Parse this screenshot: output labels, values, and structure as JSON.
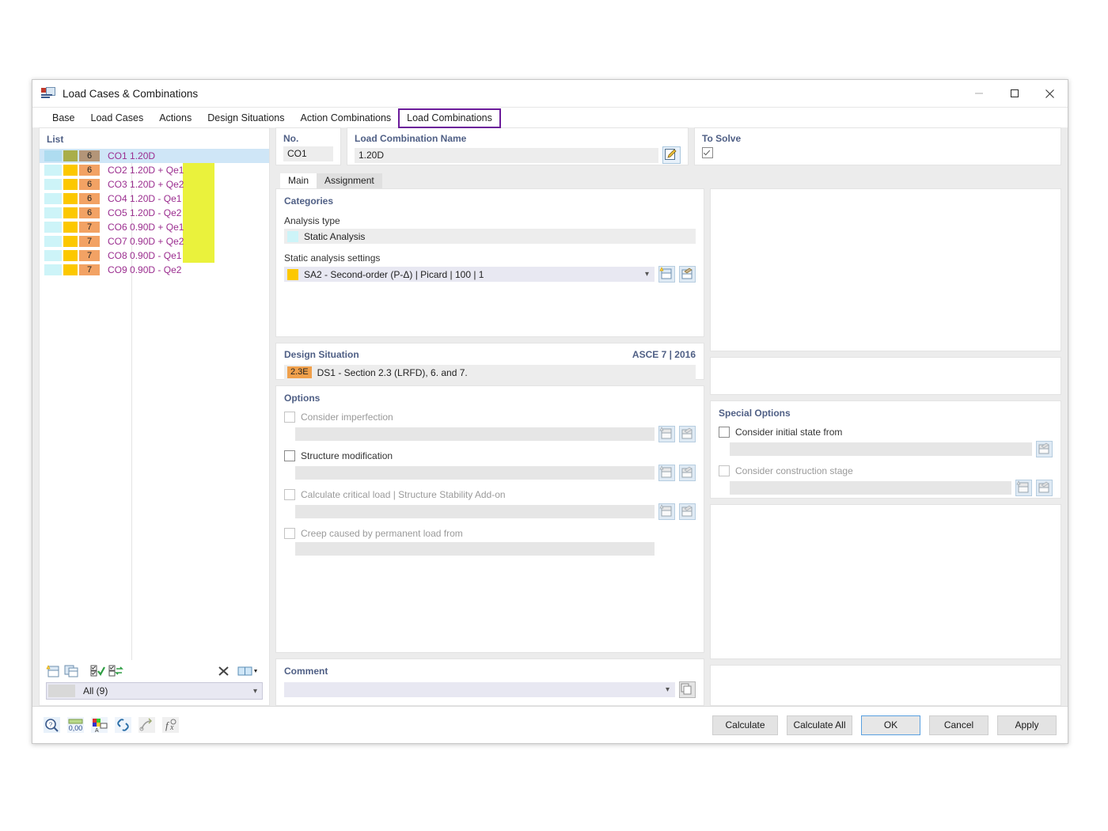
{
  "window": {
    "title": "Load Cases & Combinations",
    "icon": "load-cases-icon",
    "controls": {
      "minimize": "minimize-icon",
      "maximize": "maximize-icon",
      "close": "close-icon"
    }
  },
  "tabs": [
    {
      "label": "Base",
      "active": false
    },
    {
      "label": "Load Cases",
      "active": false
    },
    {
      "label": "Actions",
      "active": false
    },
    {
      "label": "Design Situations",
      "active": false
    },
    {
      "label": "Action Combinations",
      "active": false
    },
    {
      "label": "Load Combinations",
      "active": true,
      "highlight_color": "#6b1b9a"
    }
  ],
  "list": {
    "title": "List",
    "rows": [
      {
        "no": "6",
        "code": "CO1",
        "factor": "1.20D",
        "term": "",
        "selected": true,
        "c1": "#aedcf0",
        "c2": "#a9ae4a",
        "c3": "#b39578"
      },
      {
        "no": "6",
        "code": "CO2",
        "factor": "1.20D",
        "term": "+ Qe1",
        "selected": false,
        "c1": "#cdf4f8",
        "c2": "#fcc800",
        "c3": "#f2a264"
      },
      {
        "no": "6",
        "code": "CO3",
        "factor": "1.20D",
        "term": "+ Qe2",
        "selected": false,
        "c1": "#cdf4f8",
        "c2": "#fcc800",
        "c3": "#f2a264"
      },
      {
        "no": "6",
        "code": "CO4",
        "factor": "1.20D",
        "term": "- Qe1",
        "selected": false,
        "c1": "#cdf4f8",
        "c2": "#fcc800",
        "c3": "#f2a264"
      },
      {
        "no": "6",
        "code": "CO5",
        "factor": "1.20D",
        "term": "- Qe2",
        "selected": false,
        "c1": "#cdf4f8",
        "c2": "#fcc800",
        "c3": "#f2a264"
      },
      {
        "no": "7",
        "code": "CO6",
        "factor": "0.90D",
        "term": "+ Qe1",
        "selected": false,
        "c1": "#cdf4f8",
        "c2": "#fcc800",
        "c3": "#f2a264"
      },
      {
        "no": "7",
        "code": "CO7",
        "factor": "0.90D",
        "term": "+ Qe2",
        "selected": false,
        "c1": "#cdf4f8",
        "c2": "#fcc800",
        "c3": "#f2a264"
      },
      {
        "no": "7",
        "code": "CO8",
        "factor": "0.90D",
        "term": "- Qe1",
        "selected": false,
        "c1": "#cdf4f8",
        "c2": "#fcc800",
        "c3": "#f2a264"
      },
      {
        "no": "7",
        "code": "CO9",
        "factor": "0.90D",
        "term": "- Qe2",
        "selected": false,
        "c1": "#cdf4f8",
        "c2": "#fcc800",
        "c3": "#f2a264"
      }
    ],
    "toolbar": [
      {
        "name": "new-combination-button"
      },
      {
        "name": "copy-combination-button"
      },
      {
        "name": "select-all-button"
      },
      {
        "name": "invert-selection-button"
      },
      {
        "name": "delete-button"
      },
      {
        "name": "view-options-button"
      }
    ],
    "filter": {
      "label": "All (9)",
      "caret": "chevron-down-icon"
    }
  },
  "detail": {
    "no": {
      "label": "No.",
      "value": "CO1"
    },
    "name": {
      "label": "Load Combination Name",
      "value": "1.20D",
      "edit_icon": "edit-pencil-icon"
    },
    "to_solve": {
      "label": "To Solve",
      "checked": true
    },
    "subtabs": [
      {
        "label": "Main",
        "active": true
      },
      {
        "label": "Assignment",
        "active": false
      }
    ],
    "categories": {
      "title": "Categories",
      "analysis_type_label": "Analysis type",
      "analysis_type_value": "Static Analysis",
      "analysis_type_color": "#cdf4f8",
      "settings_label": "Static analysis settings",
      "settings_value": "SA2 - Second-order (P-Δ) | Picard | 100 | 1",
      "settings_color": "#fcc800",
      "settings_caret": "chevron-down-icon",
      "new_button": "new-item-icon",
      "edit_button": "edit-item-icon"
    },
    "design_situation": {
      "title": "Design Situation",
      "standard": "ASCE 7 | 2016",
      "badge": "2.3E",
      "badge_color": "#f0a04b",
      "value": "DS1 - Section 2.3 (LRFD), 6. and 7."
    },
    "options": {
      "title": "Options",
      "items": [
        {
          "label": "Consider imperfection",
          "checked": false,
          "disabled": true,
          "has_field": true,
          "buttons": 2
        },
        {
          "label": "Structure modification",
          "checked": false,
          "disabled": false,
          "has_field": true,
          "buttons": 2
        },
        {
          "label": "Calculate critical load | Structure Stability Add-on",
          "checked": false,
          "disabled": true,
          "has_field": true,
          "buttons": 2
        },
        {
          "label": "Creep caused by permanent load from",
          "checked": false,
          "disabled": true,
          "has_field": true,
          "buttons": 0
        }
      ]
    },
    "special_options": {
      "title": "Special Options",
      "items": [
        {
          "label": "Consider initial state from",
          "checked": false,
          "disabled": false,
          "has_field": true,
          "buttons": 1
        },
        {
          "label": "Consider construction stage",
          "checked": false,
          "disabled": true,
          "has_field": true,
          "buttons": 2
        }
      ]
    },
    "comment": {
      "title": "Comment",
      "value": "",
      "caret": "chevron-down-icon",
      "copy_button": "copy-comment-icon"
    }
  },
  "footer": {
    "tools": [
      {
        "name": "help-magnifier-icon"
      },
      {
        "name": "number-format-icon"
      },
      {
        "name": "colors-icon"
      },
      {
        "name": "link-icon"
      },
      {
        "name": "snap-icon"
      },
      {
        "name": "formula-icon"
      }
    ],
    "buttons": [
      {
        "label": "Calculate",
        "primary": false,
        "wide": true
      },
      {
        "label": "Calculate All",
        "primary": false,
        "wide": true
      },
      {
        "label": "OK",
        "primary": true,
        "wide": false
      },
      {
        "label": "Cancel",
        "primary": false,
        "wide": false
      },
      {
        "label": "Apply",
        "primary": false,
        "wide": false
      }
    ]
  }
}
